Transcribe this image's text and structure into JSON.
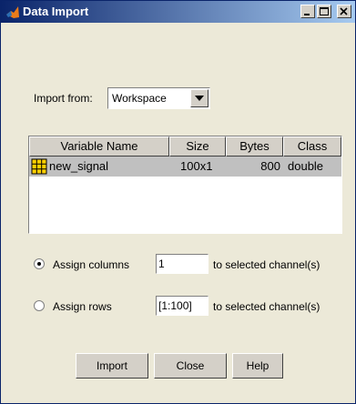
{
  "window": {
    "title": "Data Import"
  },
  "import_from": {
    "label": "Import from:",
    "value": "Workspace"
  },
  "table": {
    "columns": [
      "Variable Name",
      "Size",
      "Bytes",
      "Class"
    ],
    "rows": [
      {
        "name": "new_signal",
        "size": "100x1",
        "bytes": "800",
        "class": "double",
        "selected": true
      }
    ]
  },
  "assign": {
    "columns": {
      "label": "Assign columns",
      "value": "1",
      "suffix": "to selected channel(s)",
      "checked": true
    },
    "rows": {
      "label": "Assign rows",
      "value": "[1:100]",
      "suffix": "to selected channel(s)",
      "checked": false
    }
  },
  "buttons": {
    "import": "Import",
    "close": "Close",
    "help": "Help"
  },
  "colors": {
    "titlebar_start": "#0a246a",
    "titlebar_end": "#a6caf0",
    "dialog_bg": "#ece9d8",
    "selected_row": "#c0c0c0"
  }
}
